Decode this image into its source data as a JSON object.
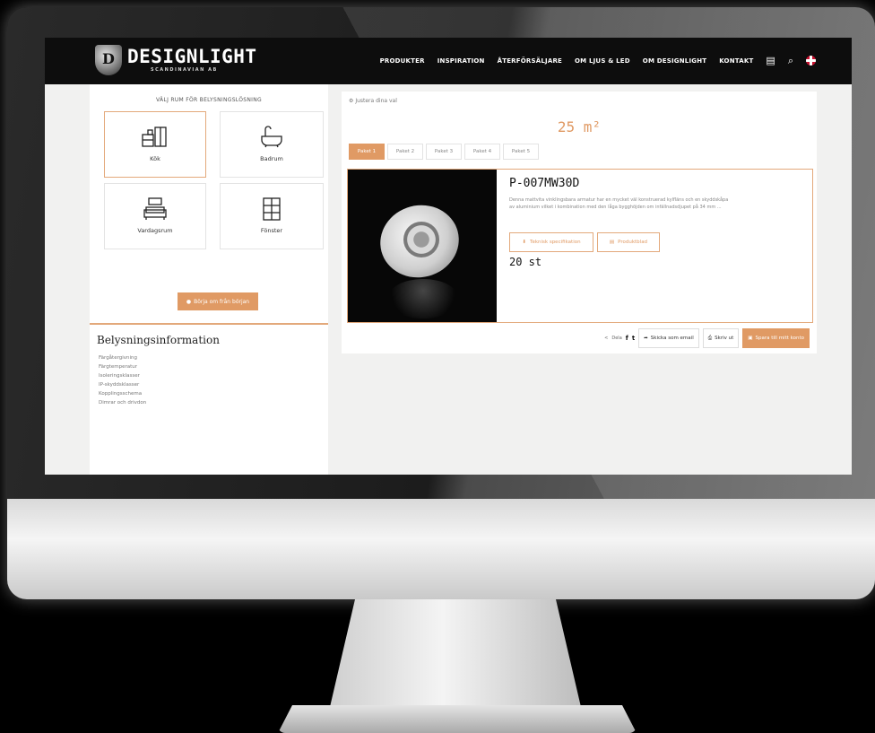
{
  "brand": {
    "logo_mark": "D",
    "name": "DESIGNLIGHT",
    "sub": "SCANDINAVIAN AB"
  },
  "nav": {
    "items": [
      "PRODUKTER",
      "INSPIRATION",
      "ÅTERFÖRSÄLJARE",
      "OM LJUS & LED",
      "OM DESIGNLIGHT",
      "KONTAKT"
    ],
    "icons": [
      "document-icon",
      "search-icon",
      "uk-flag-icon"
    ]
  },
  "rooms": {
    "title": "VÄLJ RUM FÖR BELYSNINGSLÖSNING",
    "items": [
      {
        "label": "Kök",
        "icon": "kitchen-icon",
        "glyph": "⌸",
        "active": true
      },
      {
        "label": "Badrum",
        "icon": "bathtub-icon",
        "glyph": "🛁",
        "active": false
      },
      {
        "label": "Vardagsrum",
        "icon": "sofa-icon",
        "glyph": "🛋",
        "active": false
      },
      {
        "label": "Fönster",
        "icon": "window-icon",
        "glyph": "▦",
        "active": false
      }
    ],
    "reset_label": "Börja om från början"
  },
  "info": {
    "title": "Belysningsinformation",
    "items": [
      "Färgåtergivning",
      "Färgtemperatur",
      "Isoleringsklasser",
      "IP-skyddsklasser",
      "Kopplingsschema",
      "Dimrar och drivdon"
    ]
  },
  "main": {
    "back_label": "Justera dina val",
    "area": "25 m²",
    "tabs": [
      "Paket 1",
      "Paket 2",
      "Paket 3",
      "Paket 4",
      "Paket 5"
    ],
    "active_tab": 0
  },
  "product": {
    "name": "P-007MW30D",
    "description": "Denna mattvita vinklingsbara armatur har en mycket väl konstruerad kylfläns och en skyddskåpa av aluminium vilket i kombination med den låga bygghöjden om infällnadsdjupet på 34 mm ...",
    "spec_button": "Teknisk specifikation",
    "sheet_button": "Produktblad",
    "quantity": "20 st"
  },
  "actions": {
    "share_label": "Dela",
    "email_label": "Skicka som email",
    "print_label": "Skriv ut",
    "save_label": "Spara till mitt konto"
  },
  "colors": {
    "accent": "#e09a64",
    "header_bg": "#0d0d0d",
    "page_bg": "#f1f1f0"
  }
}
